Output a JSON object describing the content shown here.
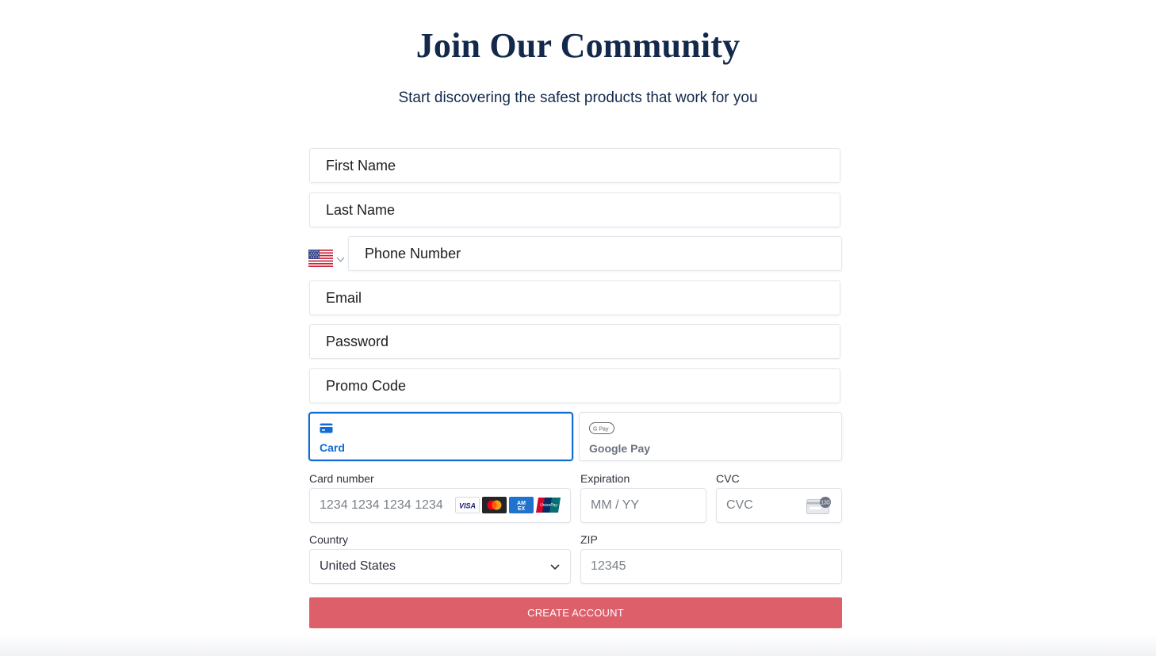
{
  "header": {
    "title": "Join Our Community",
    "subtitle": "Start discovering the safest products that work for you"
  },
  "form": {
    "first_name": {
      "placeholder": "First Name",
      "value": ""
    },
    "last_name": {
      "placeholder": "Last Name",
      "value": ""
    },
    "phone": {
      "placeholder": "Phone Number",
      "value": "",
      "country_flag": "us-flag-icon"
    },
    "email": {
      "placeholder": "Email",
      "value": ""
    },
    "password": {
      "placeholder": "Password",
      "value": ""
    },
    "promo": {
      "placeholder": "Promo Code",
      "value": ""
    }
  },
  "payment": {
    "tabs": [
      {
        "label": "Card",
        "icon": "card-icon",
        "selected": true
      },
      {
        "label": "Google Pay",
        "icon": "google-pay-icon",
        "selected": false
      }
    ],
    "card_number": {
      "label": "Card number",
      "placeholder": "1234 1234 1234 1234",
      "brands": [
        "VISA",
        "Mastercard",
        "AMEX",
        "UnionPay"
      ]
    },
    "expiration": {
      "label": "Expiration",
      "placeholder": "MM / YY"
    },
    "cvc": {
      "label": "CVC",
      "placeholder": "CVC",
      "badge": "135"
    },
    "country": {
      "label": "Country",
      "value": "United States"
    },
    "zip": {
      "label": "ZIP",
      "placeholder": "12345"
    }
  },
  "submit": {
    "label": "CREATE ACCOUNT"
  },
  "colors": {
    "title": "#13294b",
    "accent": "#0f6bd8",
    "submit_bg": "#dd5f6a"
  }
}
